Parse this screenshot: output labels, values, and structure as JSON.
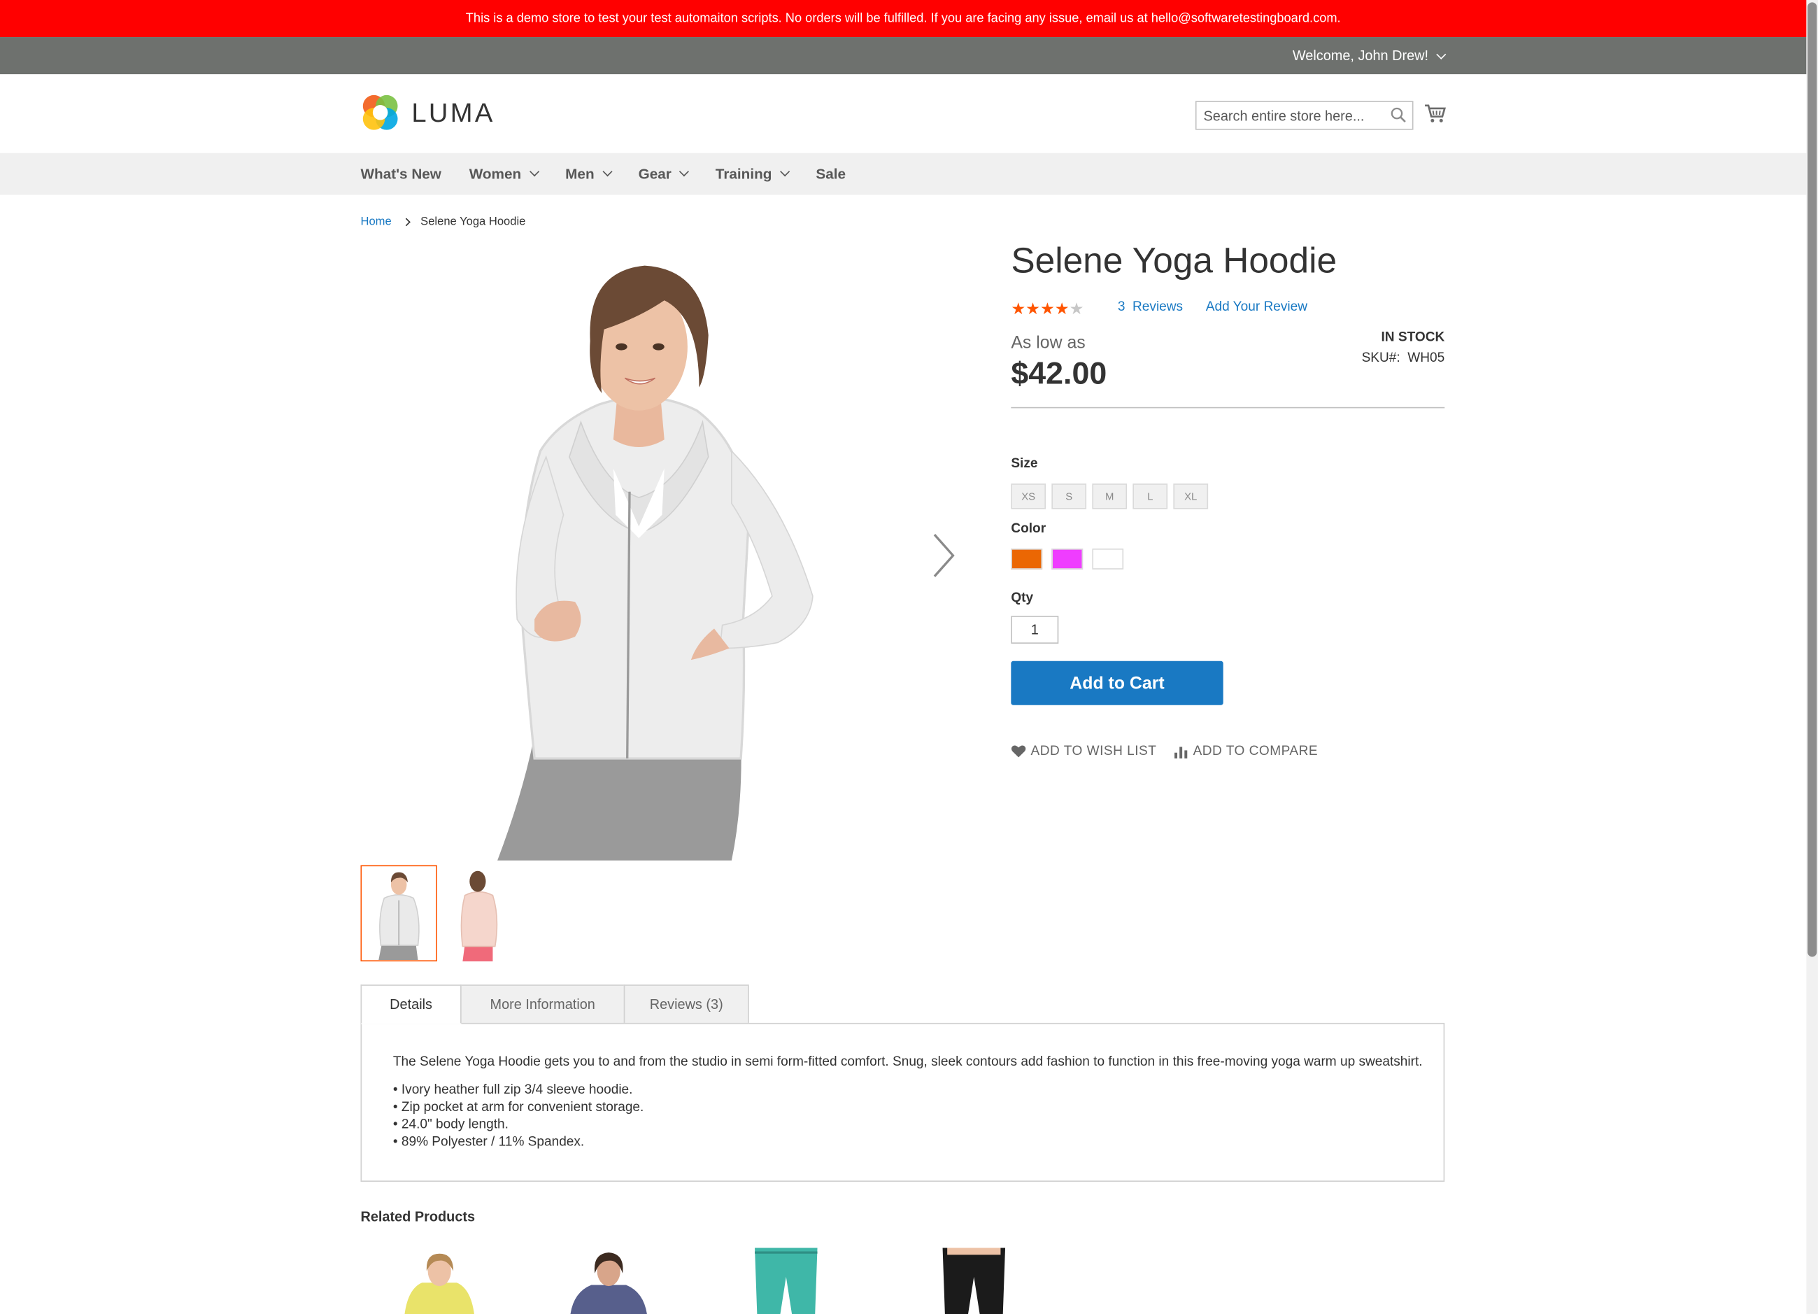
{
  "banner": {
    "text": "This is a demo store to test your test automaiton scripts. No orders will be fulfilled. If you are facing any issue, email us at hello@softwaretestingboard.com."
  },
  "header": {
    "welcome": "Welcome, John Drew!"
  },
  "brand": {
    "logo_text": "LUMA"
  },
  "search": {
    "placeholder": "Search entire store here..."
  },
  "nav": {
    "items": [
      {
        "label": "What's New",
        "has_dropdown": false
      },
      {
        "label": "Women",
        "has_dropdown": true
      },
      {
        "label": "Men",
        "has_dropdown": true
      },
      {
        "label": "Gear",
        "has_dropdown": true
      },
      {
        "label": "Training",
        "has_dropdown": true
      },
      {
        "label": "Sale",
        "has_dropdown": false
      }
    ]
  },
  "breadcrumb": {
    "home": "Home",
    "current": "Selene Yoga Hoodie"
  },
  "product": {
    "title": "Selene Yoga Hoodie",
    "rating_fraction": 0.8,
    "reviews_count": "3",
    "reviews_label": "Reviews",
    "add_review": "Add Your Review",
    "price_prefix": "As low as",
    "price": "$42.00",
    "stock": "IN STOCK",
    "sku_label": "SKU#:",
    "sku_value": "WH05"
  },
  "options": {
    "size_label": "Size",
    "sizes": [
      "XS",
      "S",
      "M",
      "L",
      "XL"
    ],
    "color_label": "Color",
    "colors": [
      "#eb6703",
      "#ef3dff",
      "#ffffff"
    ],
    "qty_label": "Qty",
    "qty_value": "1"
  },
  "actions": {
    "add_to_cart": "Add to Cart",
    "wishlist": "ADD TO WISH LIST",
    "compare": "ADD TO COMPARE"
  },
  "tabs": {
    "details": "Details",
    "more_info": "More Information",
    "reviews": "Reviews (3)"
  },
  "details": {
    "description": "The Selene Yoga Hoodie gets you to and from the studio in semi form-fitted comfort. Snug, sleek contours add fashion to function in this free-moving yoga warm up sweatshirt.",
    "bullets": [
      "• Ivory heather full zip 3/4 sleeve hoodie.",
      "• Zip pocket at arm for convenient storage.",
      "• 24.0\" body length.",
      "• 89% Polyester / 11% Spandex."
    ]
  },
  "related": {
    "title": "Related Products"
  },
  "colors": {
    "banner_bg": "#ff0000",
    "header_bg": "#6e716e",
    "nav_bg": "#f0f0f0",
    "link": "#1979c3",
    "primary_button": "#1979c3",
    "star": "#ff5501",
    "thumb_active": "#ff5501"
  }
}
